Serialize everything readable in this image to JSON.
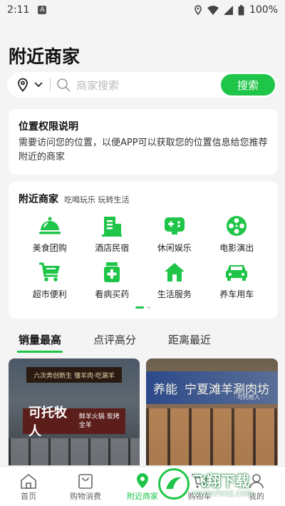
{
  "status_bar": {
    "time": "2:11",
    "battery": "100%"
  },
  "page_title": "附近商家",
  "search": {
    "placeholder": "商家搜索",
    "button": "搜索"
  },
  "permission": {
    "title": "位置权限说明",
    "body": "需要访问您的位置，以便APP可以获取您的位置信息给您推荐附近的商家"
  },
  "nearby": {
    "title": "附近商家",
    "subtitle": "吃喝玩乐 玩转生活",
    "categories": [
      {
        "label": "美食团购",
        "icon": "food-dome-icon"
      },
      {
        "label": "酒店民宿",
        "icon": "hotel-building-icon"
      },
      {
        "label": "休闲娱乐",
        "icon": "gamepad-icon"
      },
      {
        "label": "电影演出",
        "icon": "film-reel-icon"
      },
      {
        "label": "超市便利",
        "icon": "shopping-cart-icon"
      },
      {
        "label": "看病买药",
        "icon": "medicine-icon"
      },
      {
        "label": "生活服务",
        "icon": "house-icon"
      },
      {
        "label": "养车用车",
        "icon": "car-icon"
      }
    ]
  },
  "sort_tabs": [
    "销量最高",
    "点评高分",
    "距离最近"
  ],
  "shops": [
    {
      "top_sign": "六次奔创新生 懂羊肉·吃涮羊",
      "sign": "可托牧人",
      "sign_small": "鲜羊火锅 炭烤全羊"
    },
    {
      "sign": "宁夏滩羊涮肉坊",
      "sign_sub": "· 可托牧人 ·",
      "left_text": "养能"
    }
  ],
  "bottom_nav": [
    {
      "label": "首页",
      "icon": "home-icon"
    },
    {
      "label": "购物消费",
      "icon": "shopping-bag-icon"
    },
    {
      "label": "附近商家",
      "icon": "location-pin-icon"
    },
    {
      "label": "购物车",
      "icon": "cart-icon"
    },
    {
      "label": "我的",
      "icon": "user-icon"
    }
  ],
  "watermark": {
    "text": "飞翔下载",
    "url": "WWW.FXXZ.COM"
  },
  "colors": {
    "accent": "#1ec548",
    "background": "#f4f4f4"
  }
}
